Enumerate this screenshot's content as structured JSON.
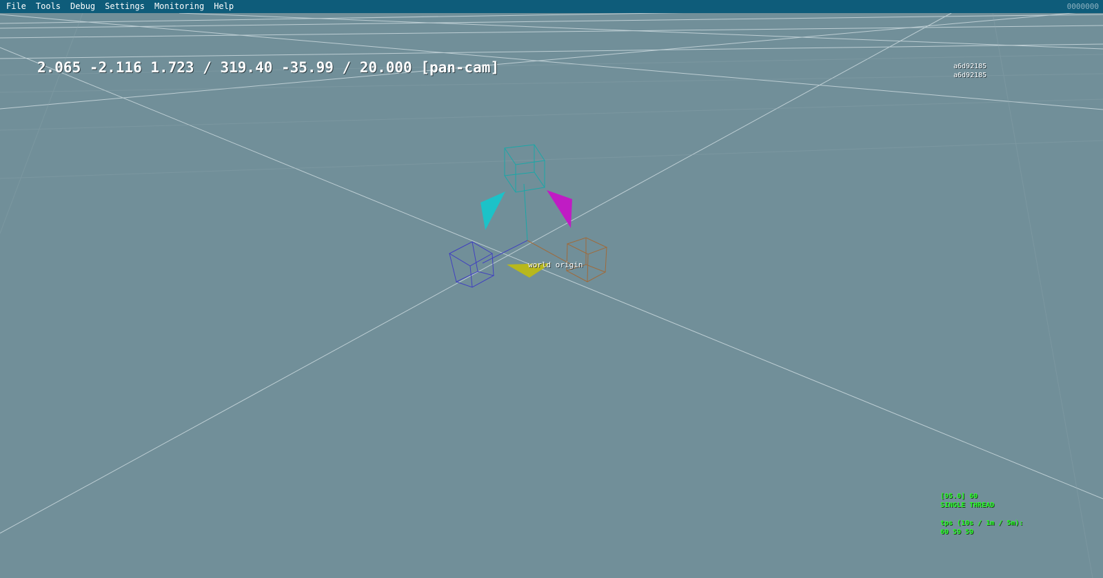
{
  "menubar": {
    "items": [
      "File",
      "Tools",
      "Debug",
      "Settings",
      "Monitoring",
      "Help"
    ],
    "right_text": "0000000"
  },
  "viewport": {
    "camera_readout": "2.065 -2.116 1.723 / 319.40 -35.99 / 20.000 [pan-cam]",
    "hashes": [
      "a6d92185",
      "a6d92185"
    ],
    "origin_label": "world origin",
    "colors": {
      "background": "#718f99",
      "grid": "#d8e4e8",
      "axis_cyan": "#1aa7a7",
      "axis_blue": "#4040c0",
      "axis_orange": "#a06a3a",
      "marker_cyan": "#1cc2c8",
      "marker_magenta": "#c01cc4",
      "marker_yellow": "#b8b81c"
    }
  },
  "stats": {
    "line1": "[95.0] 60",
    "line2": "SINGLE THREAD",
    "line3": "tps (10s / 1m / 5m):",
    "line4": "60 59 59"
  }
}
